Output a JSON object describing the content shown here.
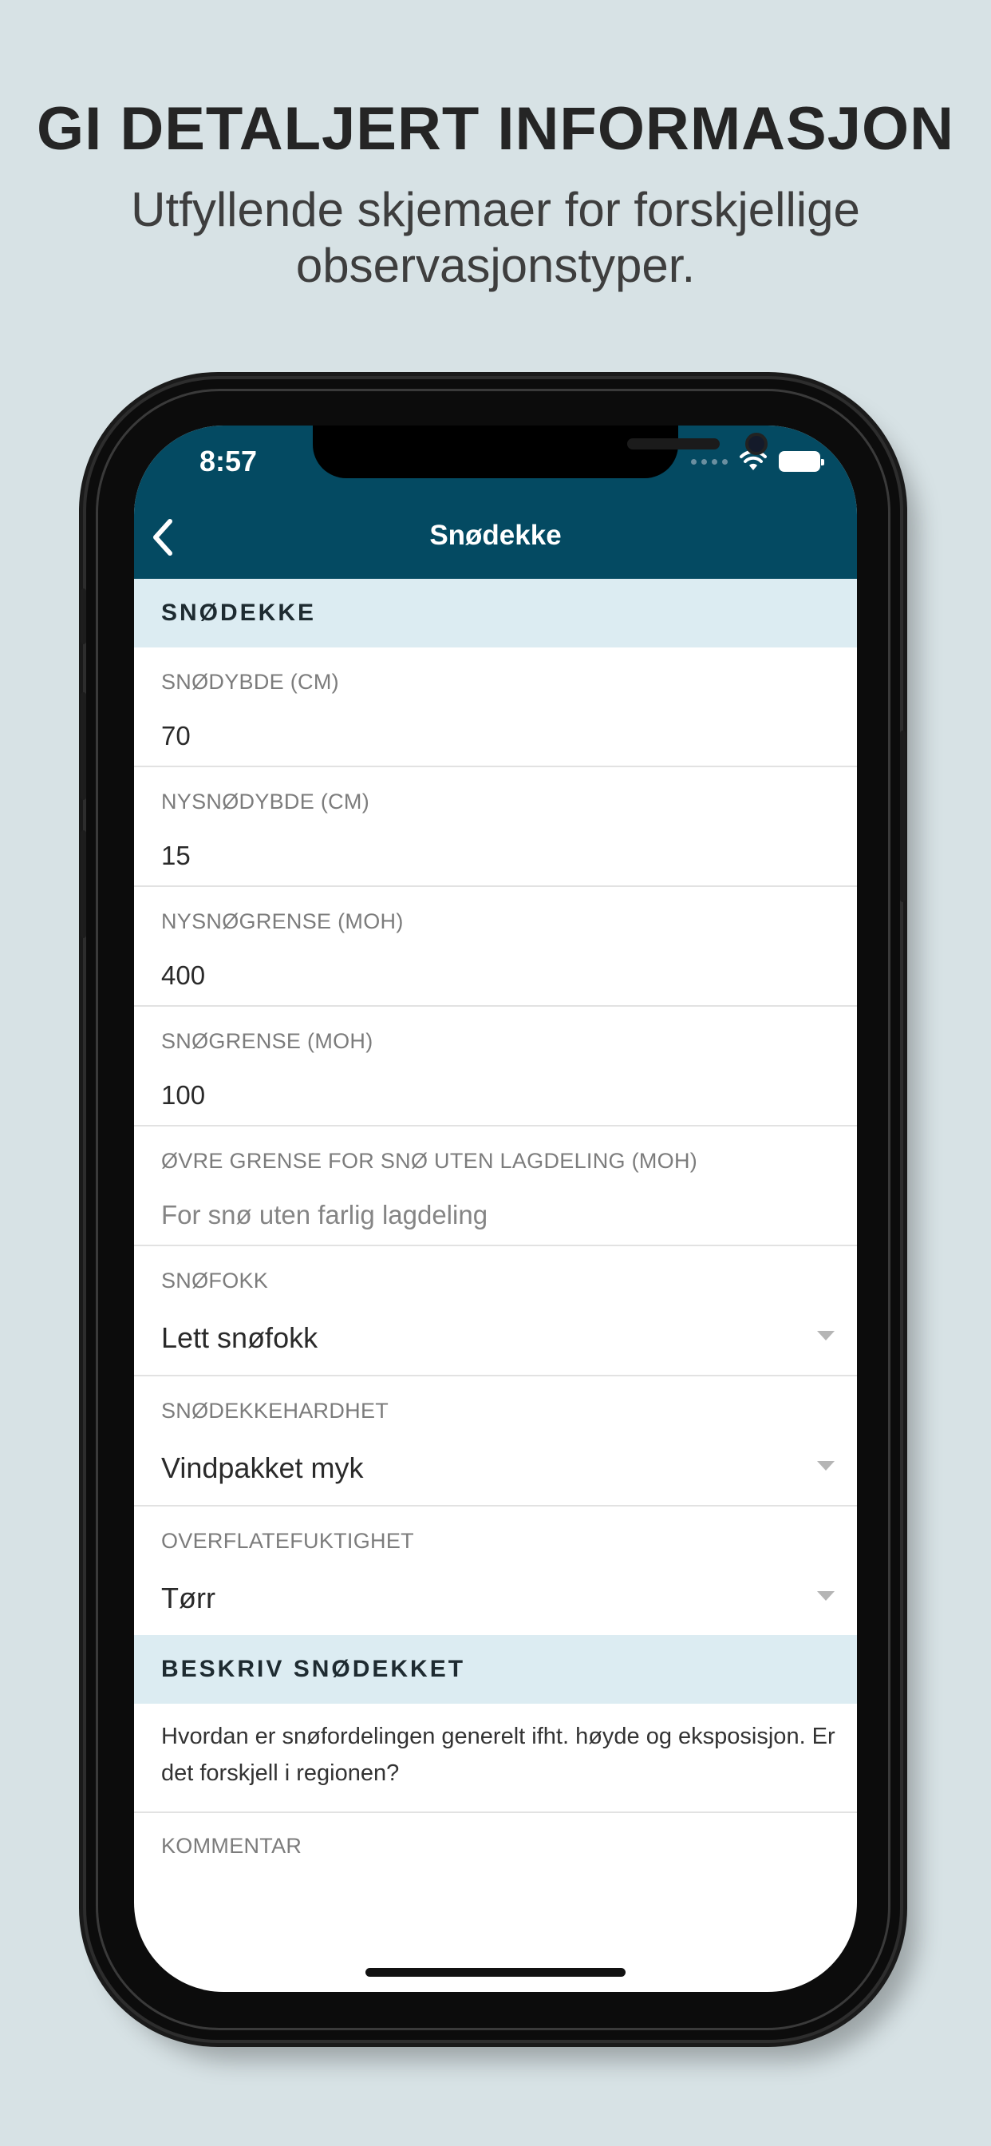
{
  "promo": {
    "headline": "GI DETALJERT INFORMASJON",
    "subline": "Utfyllende skjemaer for forskjellige observasjonstyper."
  },
  "status_bar": {
    "time": "8:57",
    "icons": [
      "signal-dots-icon",
      "wifi-icon",
      "battery-icon"
    ]
  },
  "nav": {
    "back_icon": "chevron-left-icon",
    "title": "Snødekke"
  },
  "colors": {
    "appbar": "#044a62",
    "section_header_bg": "#dcecf2",
    "background": "#d7e2e5"
  },
  "sections": {
    "snowcover": "SNØDEKKE",
    "describe": "BESKRIV SNØDEKKET"
  },
  "fields": {
    "snow_depth": {
      "label": "SNØDYBDE (CM)",
      "value": "70"
    },
    "new_snow_depth": {
      "label": "NYSNØDYBDE (CM)",
      "value": "15"
    },
    "new_snow_line": {
      "label": "NYSNØGRENSE (MOH)",
      "value": "400"
    },
    "snow_line": {
      "label": "SNØGRENSE (MOH)",
      "value": "100"
    },
    "upper_limit": {
      "label": "ØVRE GRENSE FOR SNØ UTEN LAGDELING (MOH)",
      "placeholder": "For snø uten farlig lagdeling"
    },
    "snow_drift": {
      "label": "SNØFOKK",
      "value": "Lett snøfokk"
    },
    "hardness": {
      "label": "SNØDEKKEHARDHET",
      "value": "Vindpakket myk"
    },
    "surface_moisture": {
      "label": "OVERFLATEFUKTIGHET",
      "value": "Tørr"
    },
    "comment": {
      "label": "KOMMENTAR"
    }
  },
  "describe_text": "Hvordan er snøfordelingen generelt ifht. høyde og eksposisjon. Er det forskjell i regionen?"
}
